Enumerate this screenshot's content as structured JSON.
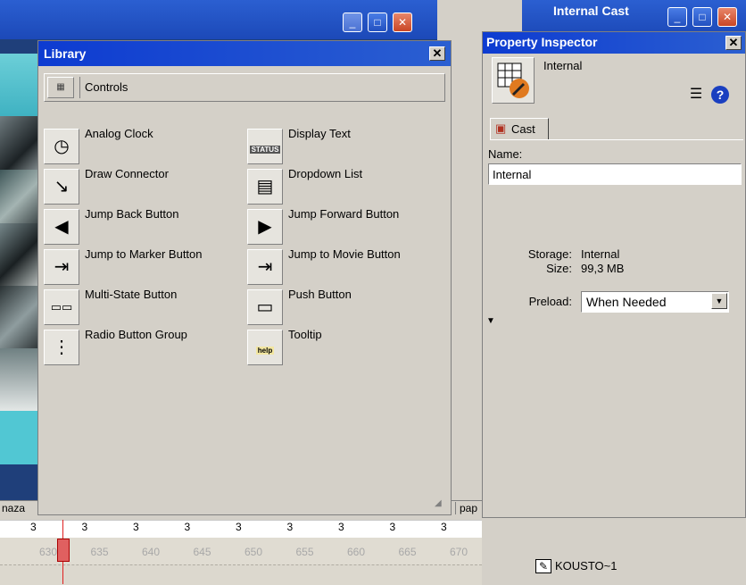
{
  "library": {
    "title": "Library",
    "category": "Controls",
    "items_left": [
      {
        "label": "Analog Clock",
        "icon": "clock-icon"
      },
      {
        "label": "Draw Connector",
        "icon": "connector-icon"
      },
      {
        "label": "Jump Back Button",
        "icon": "arrow-left-icon"
      },
      {
        "label": "Jump to Marker Button",
        "icon": "marker-icon"
      },
      {
        "label": "Multi-State Button",
        "icon": "multistate-icon"
      },
      {
        "label": "Radio Button Group",
        "icon": "radio-icon"
      }
    ],
    "items_right": [
      {
        "label": "Display Text",
        "icon": "status-text-icon",
        "icon_text": "STATUS"
      },
      {
        "label": "Dropdown List",
        "icon": "dropdown-list-icon"
      },
      {
        "label": "Jump Forward Button",
        "icon": "arrow-right-icon"
      },
      {
        "label": "Jump to Movie Button",
        "icon": "movie-jump-icon"
      },
      {
        "label": "Push Button",
        "icon": "push-button-icon"
      },
      {
        "label": "Tooltip",
        "icon": "tooltip-icon",
        "icon_text": "help"
      }
    ]
  },
  "property_inspector": {
    "title": "Property Inspector",
    "header_name": "Internal",
    "tab_label": "Cast",
    "name_label": "Name:",
    "name_value": "Internal",
    "storage_label": "Storage:",
    "storage_value": "Internal",
    "size_label": "Size:",
    "size_value": "99,3 MB",
    "preload_label": "Preload:",
    "preload_value": "When Needed"
  },
  "background": {
    "cast_window_title": "Internal Cast",
    "timeline_left_text": "naza",
    "timeline_right_text": "pap",
    "cast_member_label": "KOUSTO~1"
  },
  "timeline": {
    "channel_numbers": [
      "3",
      "3",
      "3",
      "3",
      "3",
      "3",
      "3",
      "3",
      "3"
    ],
    "frame_numbers": [
      "630",
      "635",
      "640",
      "645",
      "650",
      "655",
      "660",
      "665",
      "670"
    ]
  },
  "colors": {
    "titlebar": "#0d3bd1",
    "panel": "#d4d0c8",
    "playhead": "#e02020"
  }
}
